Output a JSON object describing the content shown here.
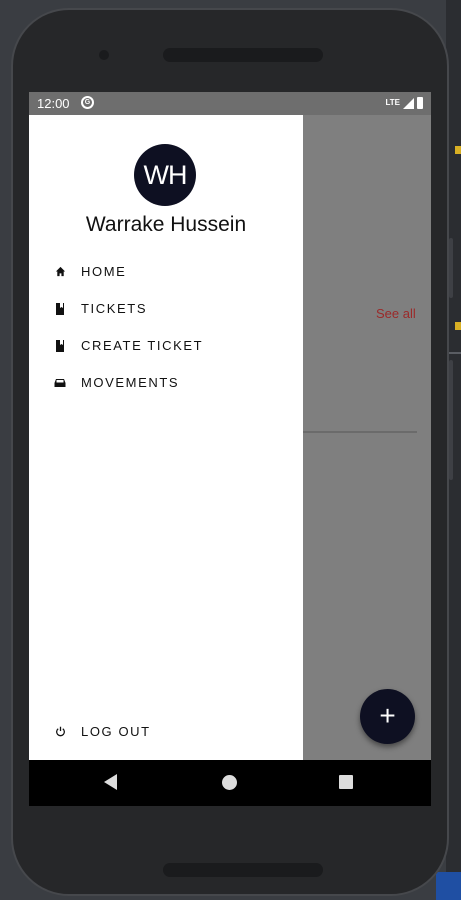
{
  "status_bar": {
    "time": "12:00",
    "network": "LTE",
    "icons": [
      "sync-icon",
      "signal-icon",
      "battery-icon"
    ]
  },
  "drawer": {
    "avatar_initials": "WH",
    "user_name": "Warrake Hussein",
    "items": [
      {
        "label": "HOME",
        "icon": "home-icon"
      },
      {
        "label": "TICKETS",
        "icon": "ticket-icon"
      },
      {
        "label": "CREATE TICKET",
        "icon": "ticket-icon"
      },
      {
        "label": "MOVEMENTS",
        "icon": "car-icon"
      }
    ],
    "logout": {
      "label": "LOG OUT",
      "icon": "power-icon"
    }
  },
  "background": {
    "see_all": "See all",
    "fab_symbol": "+"
  },
  "nav_bar": {
    "icons": [
      "back-icon",
      "home-nav-icon",
      "recents-icon"
    ]
  },
  "colors": {
    "avatar_bg": "#0e1022",
    "fab_bg": "#0e1022",
    "see_all": "#9b2a2a",
    "scrim": "#7f7f7f"
  }
}
